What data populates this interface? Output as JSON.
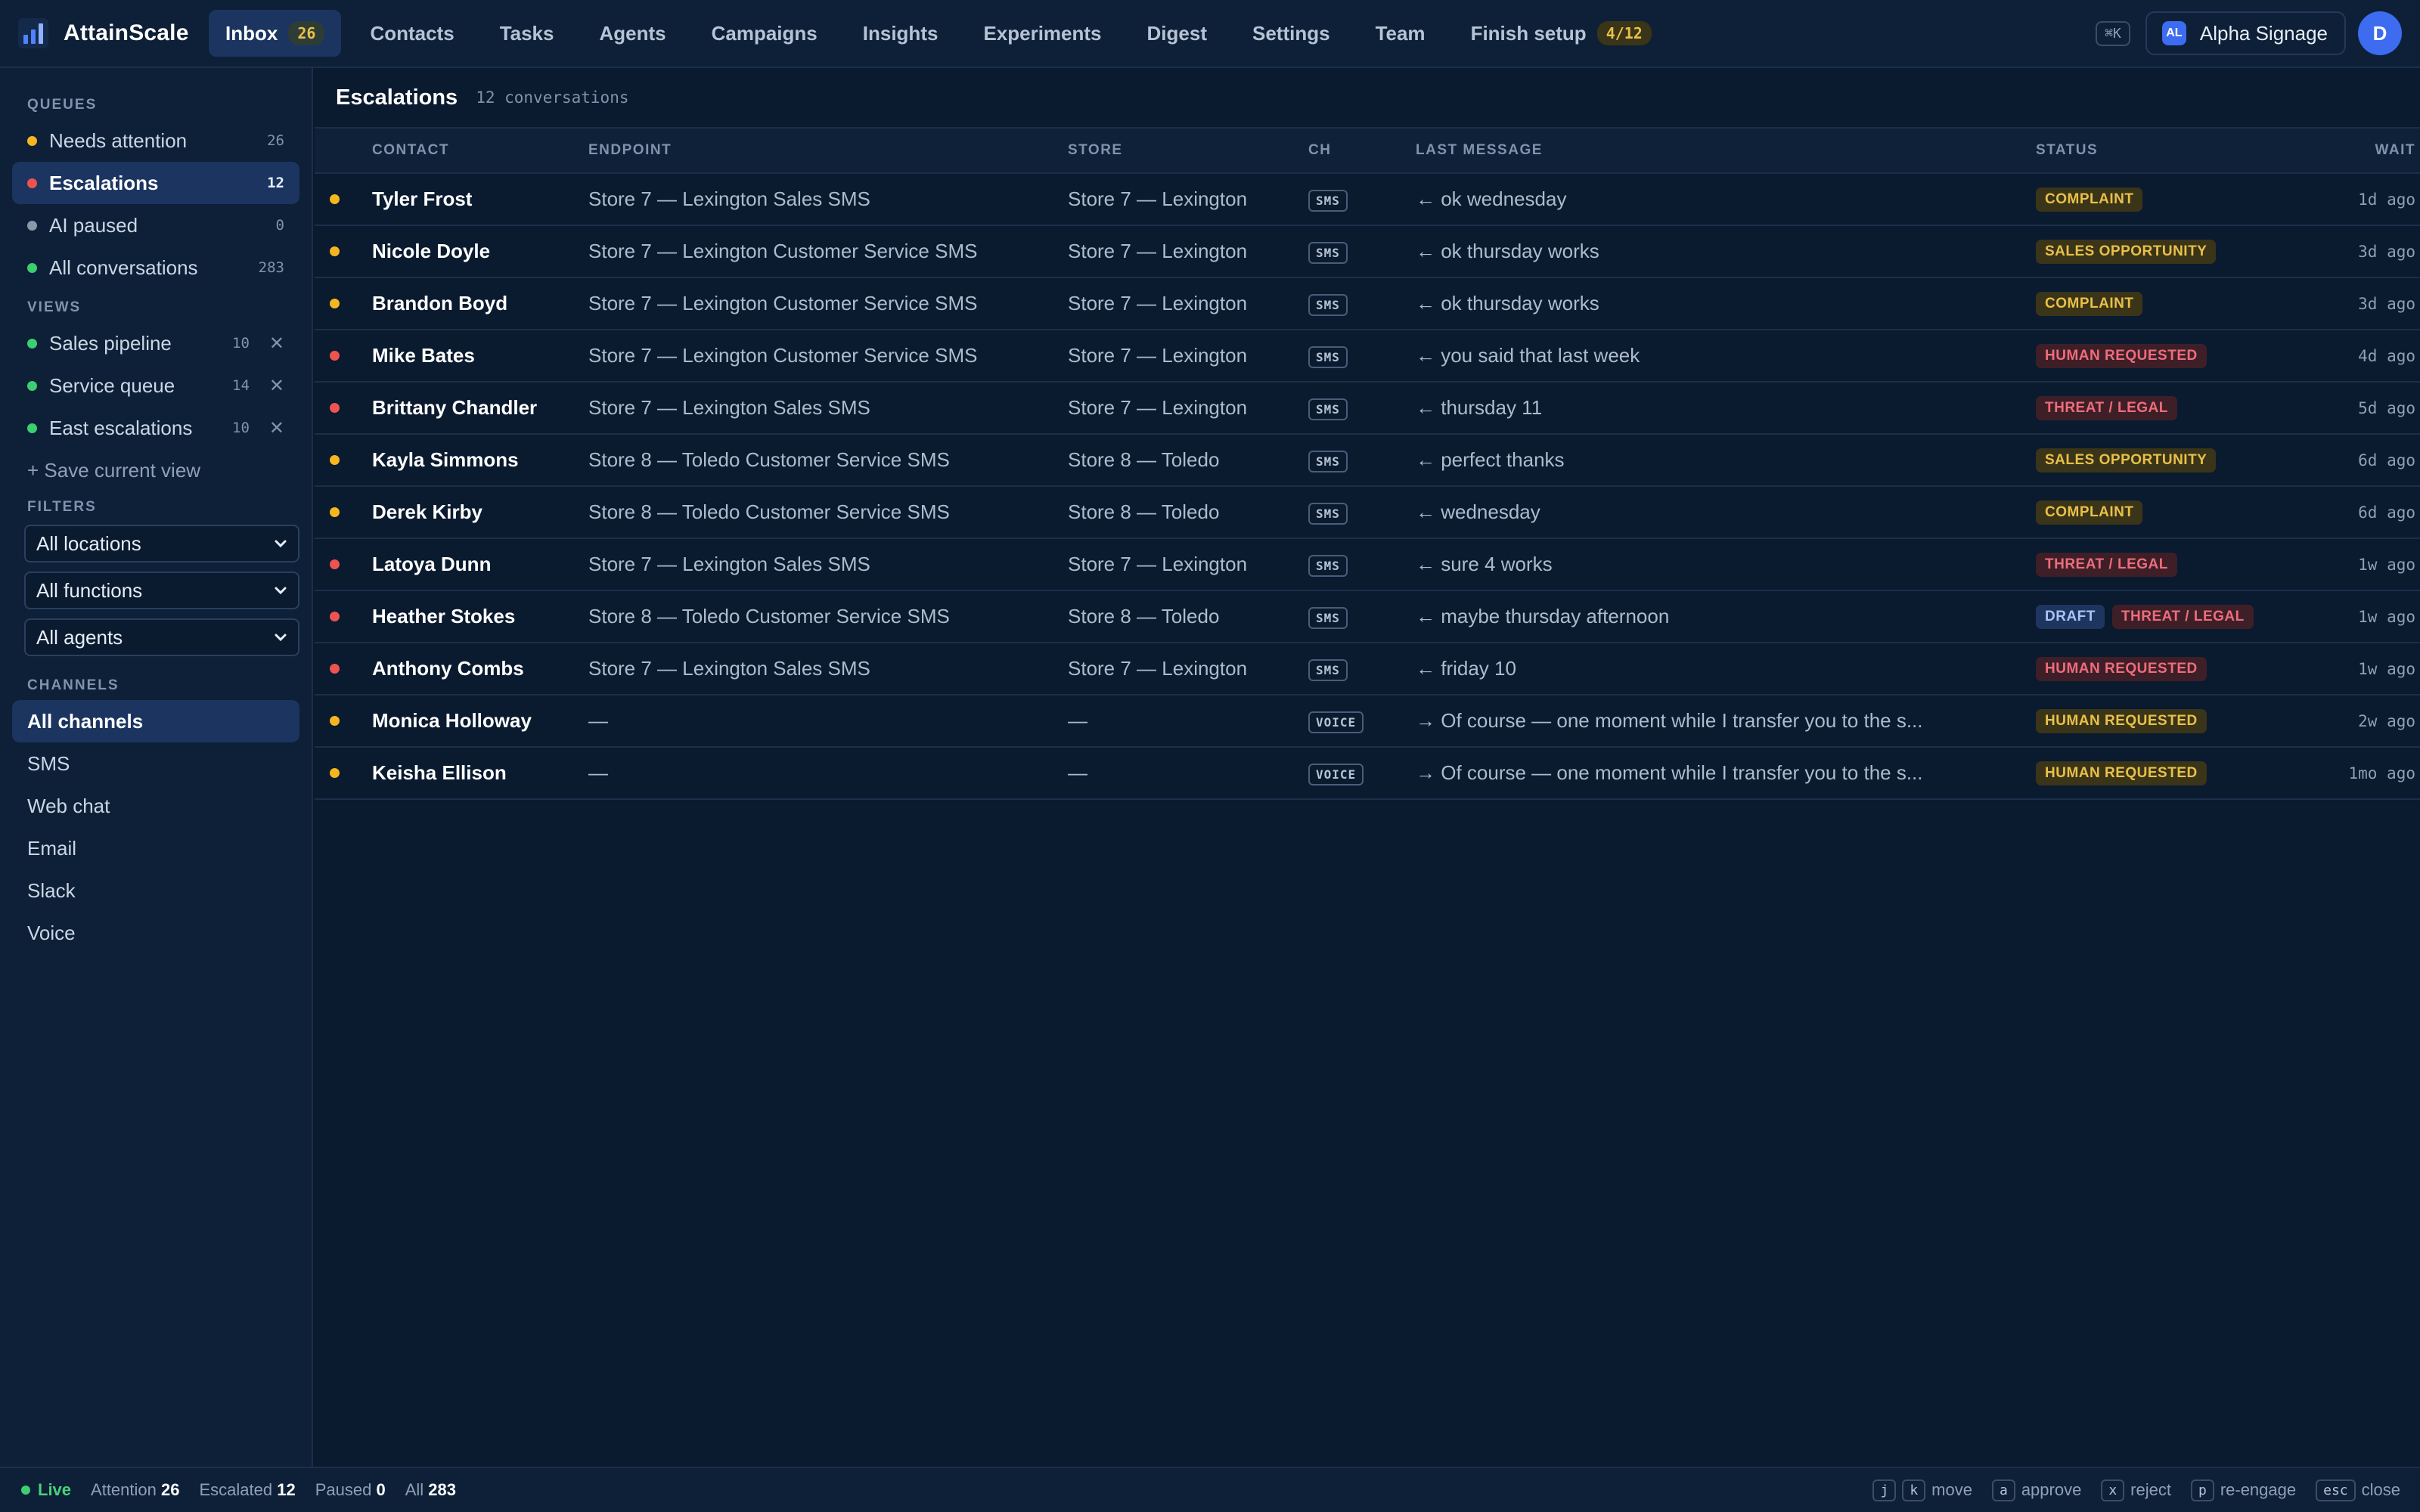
{
  "colors": {
    "yellow": "#f5b61f",
    "red": "#ef5350",
    "green": "#3ccf6f",
    "gray": "#8a98aa",
    "accent": "#3d6cf0"
  },
  "brand": {
    "name": "AttainScale",
    "icon": "bar-chart-logo-icon"
  },
  "nav": [
    {
      "label": "Inbox",
      "badge": "26",
      "active": true
    },
    {
      "label": "Contacts"
    },
    {
      "label": "Tasks"
    },
    {
      "label": "Agents"
    },
    {
      "label": "Campaigns"
    },
    {
      "label": "Insights"
    },
    {
      "label": "Experiments"
    },
    {
      "label": "Digest"
    },
    {
      "label": "Settings"
    },
    {
      "label": "Team"
    },
    {
      "label": "Finish setup",
      "badge": "4/12"
    }
  ],
  "topbar": {
    "shortcut": "⌘K",
    "org_initials": "AL",
    "org_name": "Alpha Signage",
    "user_initial": "D"
  },
  "sidebar": {
    "queues_title": "QUEUES",
    "queues": [
      {
        "label": "Needs attention",
        "count": "26",
        "dot": "yellow"
      },
      {
        "label": "Escalations",
        "count": "12",
        "dot": "red",
        "active": true
      },
      {
        "label": "AI paused",
        "count": "0",
        "dot": "gray"
      },
      {
        "label": "All conversations",
        "count": "283",
        "dot": "green"
      }
    ],
    "views_title": "VIEWS",
    "views": [
      {
        "label": "Sales pipeline",
        "count": "10",
        "dot": "green"
      },
      {
        "label": "Service queue",
        "count": "14",
        "dot": "green"
      },
      {
        "label": "East escalations",
        "count": "10",
        "dot": "green"
      }
    ],
    "close_glyph": "✕",
    "save_view": "+ Save current view",
    "filters_title": "FILTERS",
    "filters": [
      "All locations",
      "All functions",
      "All agents"
    ],
    "channels_title": "CHANNELS",
    "channels": [
      "All channels",
      "SMS",
      "Web chat",
      "Email",
      "Slack",
      "Voice"
    ]
  },
  "main": {
    "title": "Escalations",
    "subtitle": "12 conversations",
    "columns": {
      "contact": "CONTACT",
      "endpoint": "ENDPOINT",
      "store": "STORE",
      "ch": "CH",
      "last_message": "LAST MESSAGE",
      "status": "STATUS",
      "wait": "WAIT"
    },
    "rows": [
      {
        "dot": "yellow",
        "contact": "Tyler Frost",
        "endpoint": "Store 7 — Lexington Sales SMS",
        "store": "Store 7 — Lexington",
        "ch": "SMS",
        "message": "← ok wednesday",
        "tags": [
          {
            "text": "COMPLAINT",
            "kind": "complaint"
          }
        ],
        "wait": "1d ago"
      },
      {
        "dot": "yellow",
        "contact": "Nicole Doyle",
        "endpoint": "Store 7 — Lexington Customer Service SMS",
        "store": "Store 7 — Lexington",
        "ch": "SMS",
        "message": "← ok thursday works",
        "tags": [
          {
            "text": "SALES OPPORTUNITY",
            "kind": "sales"
          }
        ],
        "wait": "3d ago"
      },
      {
        "dot": "yellow",
        "contact": "Brandon Boyd",
        "endpoint": "Store 7 — Lexington Customer Service SMS",
        "store": "Store 7 — Lexington",
        "ch": "SMS",
        "message": "← ok thursday works",
        "tags": [
          {
            "text": "COMPLAINT",
            "kind": "complaint"
          }
        ],
        "wait": "3d ago"
      },
      {
        "dot": "red",
        "contact": "Mike Bates",
        "endpoint": "Store 7 — Lexington Customer Service SMS",
        "store": "Store 7 — Lexington",
        "ch": "SMS",
        "message": "← you said that last week",
        "tags": [
          {
            "text": "HUMAN REQUESTED",
            "kind": "human"
          }
        ],
        "wait": "4d ago"
      },
      {
        "dot": "red",
        "contact": "Brittany Chandler",
        "endpoint": "Store 7 — Lexington Sales SMS",
        "store": "Store 7 — Lexington",
        "ch": "SMS",
        "message": "← thursday 11",
        "tags": [
          {
            "text": "THREAT / LEGAL",
            "kind": "threat"
          }
        ],
        "wait": "5d ago"
      },
      {
        "dot": "yellow",
        "contact": "Kayla Simmons",
        "endpoint": "Store 8 — Toledo Customer Service SMS",
        "store": "Store 8 — Toledo",
        "ch": "SMS",
        "message": "← perfect thanks",
        "tags": [
          {
            "text": "SALES OPPORTUNITY",
            "kind": "sales"
          }
        ],
        "wait": "6d ago"
      },
      {
        "dot": "yellow",
        "contact": "Derek Kirby",
        "endpoint": "Store 8 — Toledo Customer Service SMS",
        "store": "Store 8 — Toledo",
        "ch": "SMS",
        "message": "← wednesday",
        "tags": [
          {
            "text": "COMPLAINT",
            "kind": "complaint"
          }
        ],
        "wait": "6d ago"
      },
      {
        "dot": "red",
        "contact": "Latoya Dunn",
        "endpoint": "Store 7 — Lexington Sales SMS",
        "store": "Store 7 — Lexington",
        "ch": "SMS",
        "message": "← sure 4 works",
        "tags": [
          {
            "text": "THREAT / LEGAL",
            "kind": "threat"
          }
        ],
        "wait": "1w ago"
      },
      {
        "dot": "red",
        "contact": "Heather Stokes",
        "endpoint": "Store 8 — Toledo Customer Service SMS",
        "store": "Store 8 — Toledo",
        "ch": "SMS",
        "message": "← maybe thursday afternoon",
        "tags": [
          {
            "text": "DRAFT",
            "kind": "draft"
          },
          {
            "text": "THREAT / LEGAL",
            "kind": "threat"
          }
        ],
        "wait": "1w ago"
      },
      {
        "dot": "red",
        "contact": "Anthony Combs",
        "endpoint": "Store 7 — Lexington Sales SMS",
        "store": "Store 7 — Lexington",
        "ch": "SMS",
        "message": "← friday 10",
        "tags": [
          {
            "text": "HUMAN REQUESTED",
            "kind": "human"
          }
        ],
        "wait": "1w ago"
      },
      {
        "dot": "yellow",
        "contact": "Monica Holloway",
        "endpoint": "—",
        "store": "—",
        "ch": "VOICE",
        "message": "→ Of course — one moment while I transfer you to the s...",
        "tags": [
          {
            "text": "HUMAN REQUESTED",
            "kind": "human-y"
          }
        ],
        "wait": "2w ago"
      },
      {
        "dot": "yellow",
        "contact": "Keisha Ellison",
        "endpoint": "—",
        "store": "—",
        "ch": "VOICE",
        "message": "→ Of course — one moment while I transfer you to the s...",
        "tags": [
          {
            "text": "HUMAN REQUESTED",
            "kind": "human-y"
          }
        ],
        "wait": "1mo ago"
      }
    ]
  },
  "statusbar": {
    "live": "Live",
    "stats": [
      {
        "label": "Attention",
        "value": "26"
      },
      {
        "label": "Escalated",
        "value": "12"
      },
      {
        "label": "Paused",
        "value": "0"
      },
      {
        "label": "All",
        "value": "283"
      }
    ],
    "shortcuts": [
      {
        "keys": [
          "j",
          "k"
        ],
        "label": "move"
      },
      {
        "keys": [
          "a"
        ],
        "label": "approve"
      },
      {
        "keys": [
          "x"
        ],
        "label": "reject"
      },
      {
        "keys": [
          "p"
        ],
        "label": "re-engage"
      },
      {
        "keys": [
          "esc"
        ],
        "label": "close"
      }
    ]
  }
}
